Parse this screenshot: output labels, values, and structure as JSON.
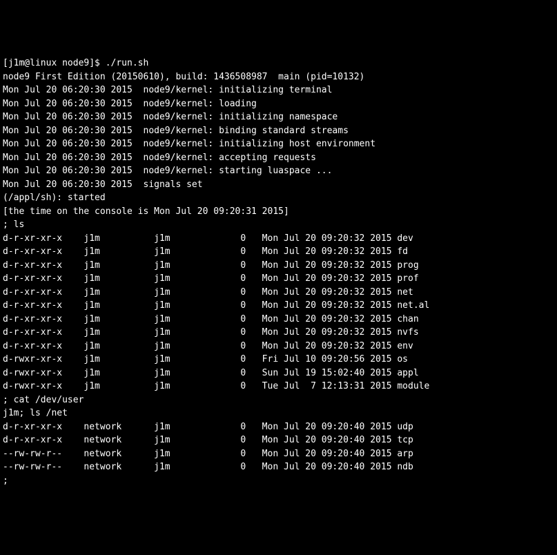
{
  "prompt_line": "[j1m@linux node9]$ ./run.sh",
  "banner": "node9 First Edition (20150610), build: 1436508987  main (pid=10132)",
  "kernel_lines": [
    "Mon Jul 20 06:20:30 2015  node9/kernel: initializing terminal",
    "Mon Jul 20 06:20:30 2015  node9/kernel: loading",
    "Mon Jul 20 06:20:30 2015  node9/kernel: initializing namespace",
    "Mon Jul 20 06:20:30 2015  node9/kernel: binding standard streams",
    "Mon Jul 20 06:20:30 2015  node9/kernel: initializing host environment",
    "Mon Jul 20 06:20:30 2015  node9/kernel: accepting requests",
    "Mon Jul 20 06:20:30 2015  node9/kernel: starting luaspace ...",
    "Mon Jul 20 06:20:30 2015  signals set"
  ],
  "shell_started": "(/appl/sh): started",
  "time_line": "[the time on the console is Mon Jul 20 09:20:31 2015]",
  "cmd_ls": "; ls",
  "ls_rows": [
    {
      "perm": "d-r-xr-xr-x",
      "owner": "j1m",
      "group": "j1m",
      "size": "0",
      "date": "Mon Jul 20 09:20:32 2015",
      "name": "dev"
    },
    {
      "perm": "d-r-xr-xr-x",
      "owner": "j1m",
      "group": "j1m",
      "size": "0",
      "date": "Mon Jul 20 09:20:32 2015",
      "name": "fd"
    },
    {
      "perm": "d-r-xr-xr-x",
      "owner": "j1m",
      "group": "j1m",
      "size": "0",
      "date": "Mon Jul 20 09:20:32 2015",
      "name": "prog"
    },
    {
      "perm": "d-r-xr-xr-x",
      "owner": "j1m",
      "group": "j1m",
      "size": "0",
      "date": "Mon Jul 20 09:20:32 2015",
      "name": "prof"
    },
    {
      "perm": "d-r-xr-xr-x",
      "owner": "j1m",
      "group": "j1m",
      "size": "0",
      "date": "Mon Jul 20 09:20:32 2015",
      "name": "net"
    },
    {
      "perm": "d-r-xr-xr-x",
      "owner": "j1m",
      "group": "j1m",
      "size": "0",
      "date": "Mon Jul 20 09:20:32 2015",
      "name": "net.al"
    },
    {
      "perm": "d-r-xr-xr-x",
      "owner": "j1m",
      "group": "j1m",
      "size": "0",
      "date": "Mon Jul 20 09:20:32 2015",
      "name": "chan"
    },
    {
      "perm": "d-r-xr-xr-x",
      "owner": "j1m",
      "group": "j1m",
      "size": "0",
      "date": "Mon Jul 20 09:20:32 2015",
      "name": "nvfs"
    },
    {
      "perm": "d-r-xr-xr-x",
      "owner": "j1m",
      "group": "j1m",
      "size": "0",
      "date": "Mon Jul 20 09:20:32 2015",
      "name": "env"
    },
    {
      "perm": "d-rwxr-xr-x",
      "owner": "j1m",
      "group": "j1m",
      "size": "0",
      "date": "Fri Jul 10 09:20:56 2015",
      "name": "os"
    },
    {
      "perm": "d-rwxr-xr-x",
      "owner": "j1m",
      "group": "j1m",
      "size": "0",
      "date": "Sun Jul 19 15:02:40 2015",
      "name": "appl"
    },
    {
      "perm": "d-rwxr-xr-x",
      "owner": "j1m",
      "group": "j1m",
      "size": "0",
      "date": "Tue Jul  7 12:13:31 2015",
      "name": "module"
    }
  ],
  "cmd_cat": "; cat /dev/user",
  "cat_result_and_lsnet": "j1m; ls /net",
  "net_rows": [
    {
      "perm": "d-r-xr-xr-x",
      "owner": "network",
      "group": "j1m",
      "size": "0",
      "date": "Mon Jul 20 09:20:40 2015",
      "name": "udp"
    },
    {
      "perm": "d-r-xr-xr-x",
      "owner": "network",
      "group": "j1m",
      "size": "0",
      "date": "Mon Jul 20 09:20:40 2015",
      "name": "tcp"
    },
    {
      "perm": "--rw-rw-r--",
      "owner": "network",
      "group": "j1m",
      "size": "0",
      "date": "Mon Jul 20 09:20:40 2015",
      "name": "arp"
    },
    {
      "perm": "--rw-rw-r--",
      "owner": "network",
      "group": "j1m",
      "size": "0",
      "date": "Mon Jul 20 09:20:40 2015",
      "name": "ndb"
    }
  ],
  "final_prompt": ";"
}
